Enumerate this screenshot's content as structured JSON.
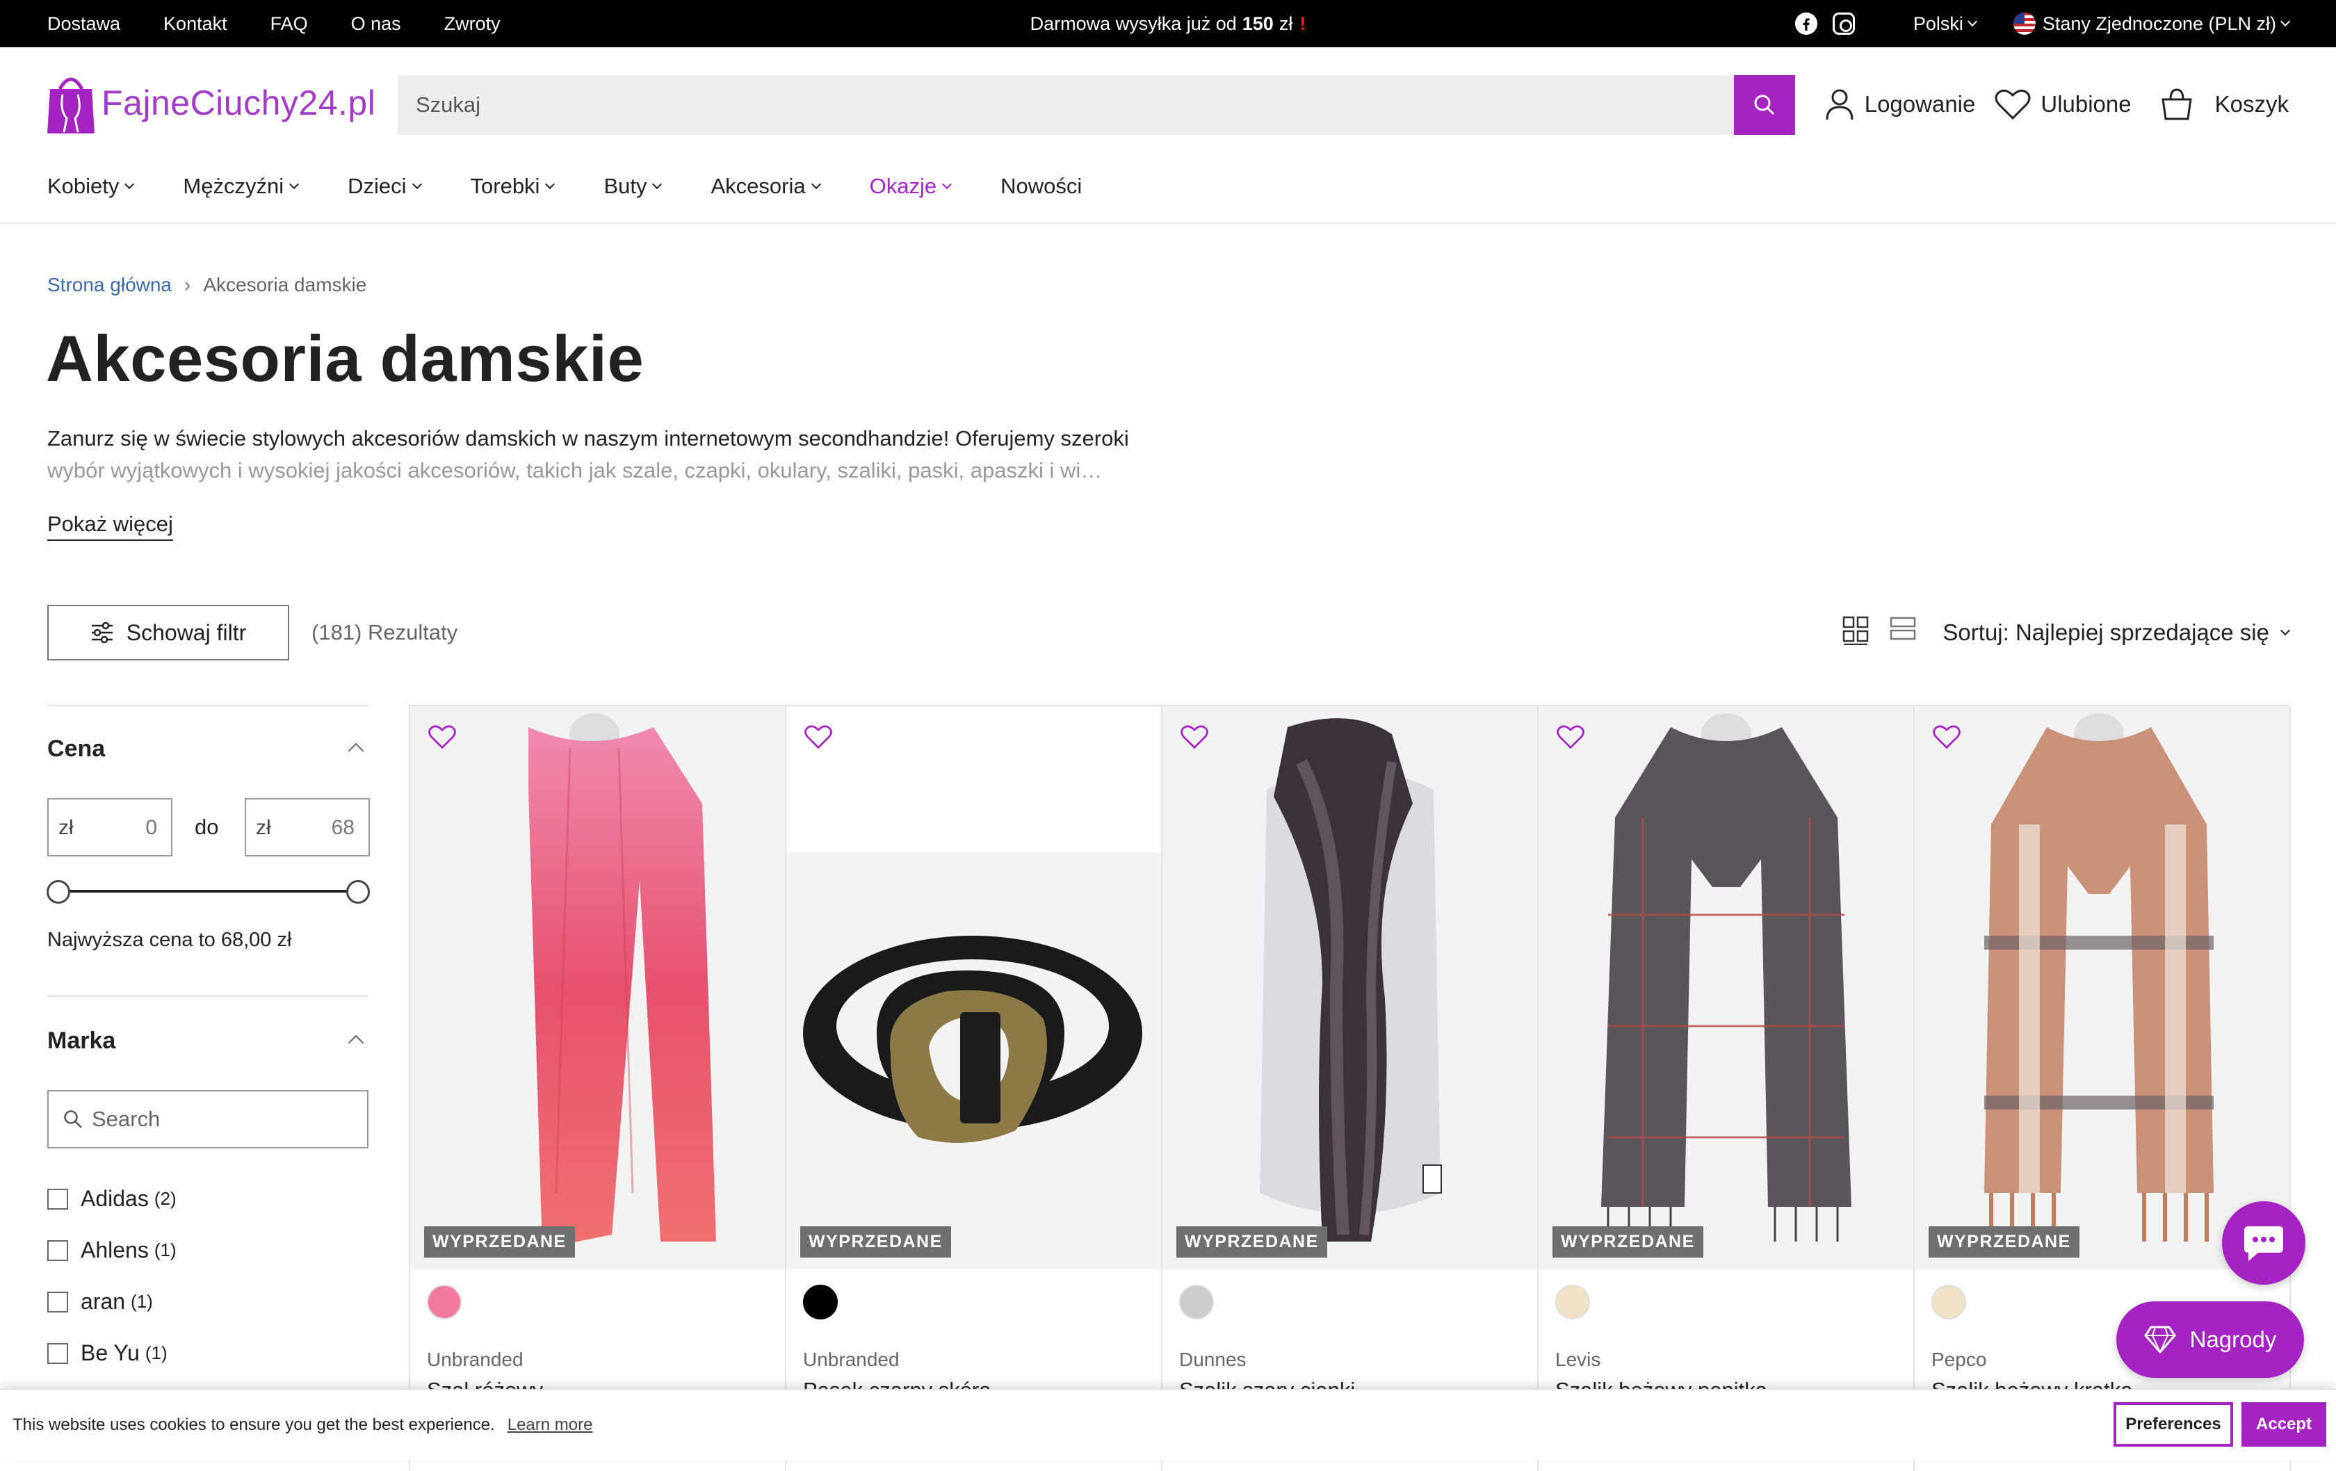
{
  "topbar": {
    "links": [
      "Dostawa",
      "Kontakt",
      "FAQ",
      "O nas",
      "Zwroty"
    ],
    "promo_text": "Darmowa wysyłka już od",
    "promo_amount": "150",
    "promo_currency": "zł",
    "promo_mark": "!",
    "language": "Polski",
    "country": "Stany Zjednoczone (PLN zł)"
  },
  "header": {
    "logo_text": "FajneCiuchy24.pl",
    "search_placeholder": "Szukaj",
    "login": "Logowanie",
    "favorites": "Ulubione",
    "cart": "Koszyk"
  },
  "nav": {
    "items": [
      "Kobiety",
      "Mężczyźni",
      "Dzieci",
      "Torebki",
      "Buty",
      "Akcesoria",
      "Okazje",
      "Nowości"
    ]
  },
  "breadcrumb": {
    "home": "Strona główna",
    "current": "Akcesoria damskie"
  },
  "page": {
    "title": "Akcesoria damskie",
    "description_line1": "Zanurz się w świecie stylowych akcesoriów damskich w naszym internetowym secondhandzie! Oferujemy szeroki",
    "description_line2": "wybór wyjątkowych i wysokiej jakości akcesoriów, takich jak szale, czapki, okulary, szaliki, paski, apaszki i wi…",
    "show_more": "Pokaż więcej"
  },
  "toolbar": {
    "filter_button": "Schowaj filtr",
    "results": "(181) Rezultaty",
    "sort": "Sortuj: Najlepiej sprzedające się"
  },
  "filters": {
    "price": {
      "title": "Cena",
      "currency": "zł",
      "min": "0",
      "max": "68",
      "to_label": "do",
      "max_note": "Najwyższa cena to 68,00 zł"
    },
    "brand": {
      "title": "Marka",
      "search_placeholder": "Search",
      "options": [
        {
          "label": "Adidas",
          "count": "(2)"
        },
        {
          "label": "Ahlens",
          "count": "(1)"
        },
        {
          "label": "aran",
          "count": "(1)"
        },
        {
          "label": "Be Yu",
          "count": "(1)"
        }
      ]
    }
  },
  "products": [
    {
      "badge": "WYPRZEDANE",
      "brand": "Unbranded",
      "name": "Szal różowy",
      "swatch": "#f27a9e",
      "icon": "pink-scarf-image"
    },
    {
      "badge": "WYPRZEDANE",
      "brand": "Unbranded",
      "name": "Pasek czarny skóra",
      "swatch": "#000000",
      "icon": "black-belt-image"
    },
    {
      "badge": "WYPRZEDANE",
      "brand": "Dunnes",
      "name": "Szalik szary cianki",
      "swatch": "#cccccc",
      "icon": "grey-fur-scarf-image"
    },
    {
      "badge": "WYPRZEDANE",
      "brand": "Levis",
      "name": "Szalik beżowy pepitka",
      "swatch": "#efe2c6",
      "icon": "grey-plaid-scarf-image"
    },
    {
      "badge": "WYPRZEDANE",
      "brand": "Pepco",
      "name": "Szalik beżowy kratka",
      "swatch": "#efe2c6",
      "icon": "beige-check-scarf-image"
    }
  ],
  "cookie": {
    "message": "This website uses cookies to ensure you get the best experience.",
    "learn_more": "Learn more",
    "preferences": "Preferences",
    "accept": "Accept"
  },
  "rewards": {
    "label": "Nagrody"
  },
  "colors": {
    "accent": "#a523c3",
    "link": "#3a68a8",
    "badge": "#6f6f6f"
  }
}
